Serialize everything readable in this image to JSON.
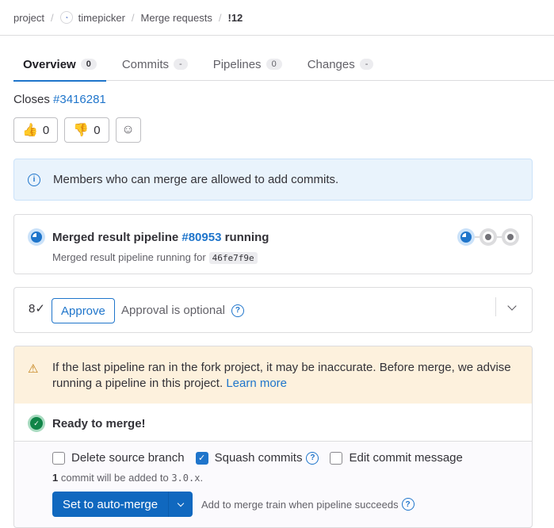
{
  "breadcrumb": {
    "items": [
      "project",
      "timepicker",
      "Merge requests",
      "!12"
    ],
    "project_avatar": "project-avatar-icon"
  },
  "tabs": [
    {
      "label": "Overview",
      "count": "0",
      "active": true
    },
    {
      "label": "Commits",
      "count": "-"
    },
    {
      "label": "Pipelines",
      "count": "0"
    },
    {
      "label": "Changes",
      "count": "-"
    }
  ],
  "closes": {
    "label": "Closes",
    "issue": "#3416281"
  },
  "awards": [
    {
      "emoji": "👍",
      "count": "0"
    },
    {
      "emoji": "👎",
      "count": "0"
    },
    {
      "emoji": "☺"
    }
  ],
  "info_alert": {
    "text": "Members who can merge are allowed to add commits."
  },
  "pipeline": {
    "title_prefix": "Merged result pipeline",
    "id": "#80953",
    "status": "running",
    "subtitle": "Merged result pipeline running for",
    "sha": "46fe7f9e",
    "stages": [
      "running",
      "created",
      "created"
    ]
  },
  "approval": {
    "icon": "8✓",
    "button": "Approve",
    "text": "Approval is optional"
  },
  "merge": {
    "warning": "If the last pipeline ran in the fork project, it may be inaccurate. Before merge, we advise running a pipeline in this project.",
    "learn_more": "Learn more",
    "ready": "Ready to merge!",
    "options": [
      {
        "label": "Delete source branch",
        "checked": false
      },
      {
        "label": "Squash commits",
        "checked": true
      },
      {
        "label": "Edit commit message",
        "checked": false
      }
    ],
    "commit_count": "1",
    "commit_text": "commit will be added to",
    "target_branch": "3.0.x",
    "button": "Set to auto-merge",
    "merge_train_text": "Add to merge train when pipeline succeeds"
  }
}
